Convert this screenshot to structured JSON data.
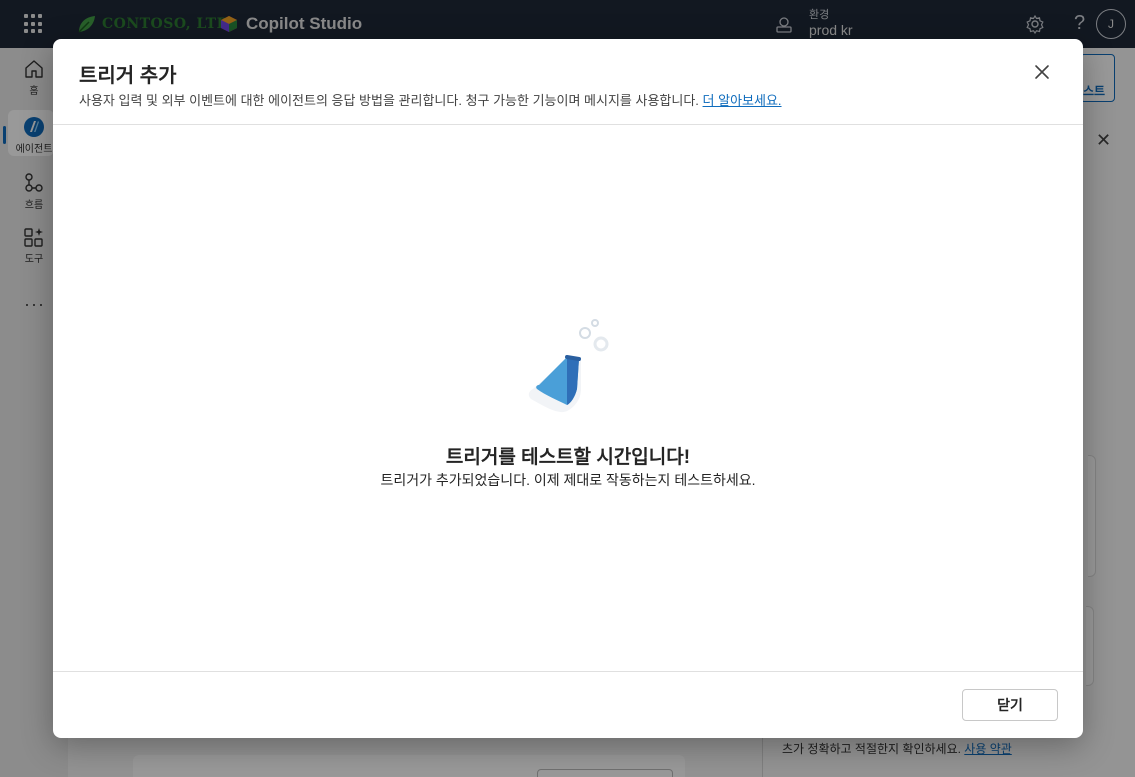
{
  "topbar": {
    "org_name": "CONTOSO, LTD.",
    "app_name": "Copilot Studio",
    "env_label": "환경",
    "env_value": "prod kr",
    "help": "?",
    "avatar_initial": "J"
  },
  "rail": {
    "items": [
      {
        "label": "홈",
        "icon": "home-icon"
      },
      {
        "label": "에이전트",
        "icon": "agent-icon"
      },
      {
        "label": "흐름",
        "icon": "flow-icon"
      },
      {
        "label": "도구",
        "icon": "tools-icon"
      }
    ],
    "more": "···"
  },
  "background": {
    "test_partial": "스트",
    "terms_text": "츠가 정확하고 적절한지 확인하세요.",
    "terms_link": "사용 약관"
  },
  "modal": {
    "title": "트리거 추가",
    "description": "사용자 입력 및 외부 이벤트에 대한 에이전트의 응답 방법을 관리합니다. 청구 가능한 기능이며 메시지를 사용합니다.",
    "learn_more": "더 알아보세요.",
    "heading": "트리거를 테스트할 시간입니다!",
    "subtext": "트리거가 추가되었습니다. 이제 제대로 작동하는지 테스트하세요.",
    "close_label": "닫기"
  },
  "colors": {
    "topbar": "#1f2938",
    "accent": "#0f6cbd",
    "flask": "#4a9fd8"
  }
}
